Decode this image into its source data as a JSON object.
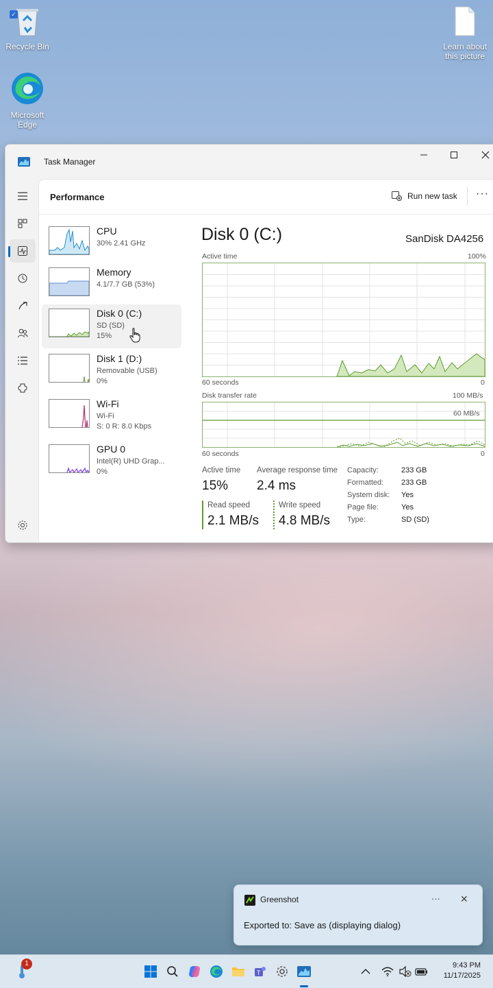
{
  "desktop": {
    "recycle_bin_label": "Recycle Bin",
    "edge_label_line1": "Microsoft",
    "edge_label_line2": "Edge",
    "learn_label_line1": "Learn about",
    "learn_label_line2": "this picture"
  },
  "window": {
    "title": "Task Manager"
  },
  "header": {
    "page_title": "Performance",
    "run_new_task": "Run new task",
    "more": "···"
  },
  "resources": [
    {
      "name": "CPU",
      "sub1": "30%  2.41 GHz",
      "sub2": ""
    },
    {
      "name": "Memory",
      "sub1": "4.1/7.7 GB (53%)",
      "sub2": ""
    },
    {
      "name": "Disk 0 (C:)",
      "sub1": "SD (SD)",
      "sub2": "15%"
    },
    {
      "name": "Disk 1 (D:)",
      "sub1": "Removable (USB)",
      "sub2": "0%"
    },
    {
      "name": "Wi-Fi",
      "sub1": "Wi-Fi",
      "sub2": "S: 0  R: 8.0 Kbps"
    },
    {
      "name": "GPU 0",
      "sub1": "Intel(R) UHD Grap...",
      "sub2": "0%"
    }
  ],
  "detail": {
    "title": "Disk 0 (C:)",
    "model": "SanDisk DA4256",
    "graph1_label": "Active time",
    "graph1_max": "100%",
    "graph1_time": "60 seconds",
    "graph1_min": "0",
    "graph2_label": "Disk transfer rate",
    "graph2_max": "100 MB/s",
    "graph2_line": "60 MB/s",
    "graph2_time": "60 seconds",
    "graph2_min": "0",
    "active_time_label": "Active time",
    "active_time_value": "15%",
    "avg_response_label": "Average response time",
    "avg_response_value": "2.4 ms",
    "read_label": "Read speed",
    "read_value": "2.1 MB/s",
    "write_label": "Write speed",
    "write_value": "4.8 MB/s",
    "props": [
      {
        "label": "Capacity:",
        "value": "233 GB"
      },
      {
        "label": "Formatted:",
        "value": "233 GB"
      },
      {
        "label": "System disk:",
        "value": "Yes"
      },
      {
        "label": "Page file:",
        "value": "Yes"
      },
      {
        "label": "Type:",
        "value": "SD (SD)"
      }
    ]
  },
  "toast": {
    "app": "Greenshot",
    "message": "Exported to: Save as (displaying dialog)",
    "more": "···",
    "close": "✕"
  },
  "taskbar": {
    "badge_count": "1",
    "time": "9:43 PM",
    "date": "11/17/2025"
  },
  "colors": {
    "accent": "#0067c0",
    "disk_green": "#8ab06e",
    "disk_fill": "#d3e9bd",
    "cpu_blue": "#1f8ec9",
    "memory_blue": "#9fbfe6",
    "wifi_pink": "#b52e6e",
    "gpu_purple": "#7c3aed"
  }
}
